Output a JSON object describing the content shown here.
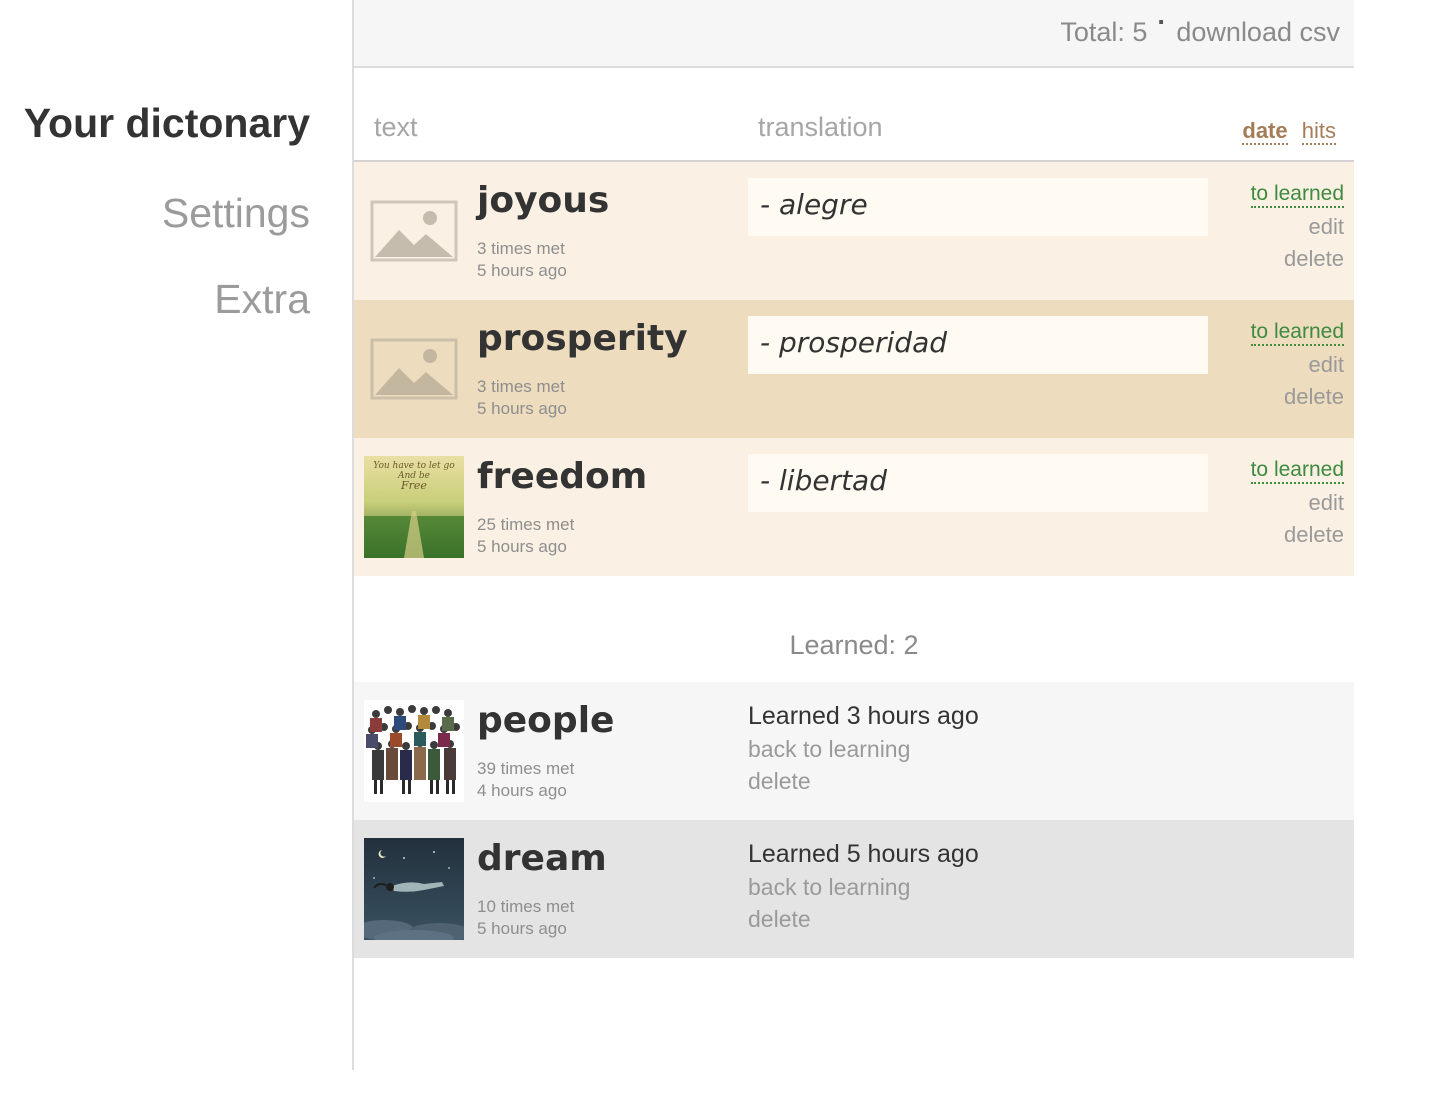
{
  "nav": {
    "items": [
      {
        "label": "Your dictonary"
      },
      {
        "label": "Settings"
      },
      {
        "label": "Extra"
      }
    ]
  },
  "topbar": {
    "total": "Total: 5",
    "separator": "·",
    "download": "download csv"
  },
  "columns": {
    "text": "text",
    "translation": "translation",
    "sort_date": "date",
    "sort_hits": "hits"
  },
  "words": [
    {
      "word": "joyous",
      "met": "3 times met",
      "ago": "5 hours ago",
      "translation": "- alegre",
      "image": "placeholder-image-icon"
    },
    {
      "word": "prosperity",
      "met": "3 times met",
      "ago": "5 hours ago",
      "translation": "- prosperidad",
      "image": "placeholder-image-icon"
    },
    {
      "word": "freedom",
      "met": "25 times met",
      "ago": "5 hours ago",
      "translation": "- libertad",
      "image": "freedom-photo"
    }
  ],
  "actions": {
    "to_learned": "to learned",
    "edit": "edit",
    "delete": "delete"
  },
  "learned": {
    "title": "Learned: 2",
    "back": "back to learning",
    "delete": "delete",
    "items": [
      {
        "word": "people",
        "met": "39 times met",
        "ago": "4 hours ago",
        "when": "Learned 3 hours ago",
        "image": "crowd-photo"
      },
      {
        "word": "dream",
        "met": "10 times met",
        "ago": "5 hours ago",
        "when": "Learned 5 hours ago",
        "image": "night-sky-photo"
      }
    ]
  }
}
